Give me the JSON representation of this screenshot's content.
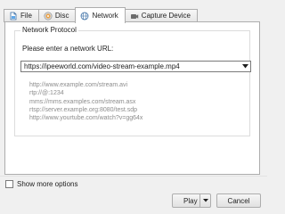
{
  "tabs": [
    {
      "label": "File",
      "icon": "file-icon",
      "active": false
    },
    {
      "label": "Disc",
      "icon": "disc-icon",
      "active": false
    },
    {
      "label": "Network",
      "icon": "network-icon",
      "active": true
    },
    {
      "label": "Capture Device",
      "icon": "capture-device-icon",
      "active": false
    }
  ],
  "network": {
    "group_title": "Network Protocol",
    "prompt": "Please enter a network URL:",
    "url_value": "https://ipeeworld.com/video-stream-example.mp4",
    "examples": [
      "http://www.example.com/stream.avi",
      "rtp://@:1234",
      "mms://mms.examples.com/stream.asx",
      "rtsp://server.example.org:8080/test.sdp",
      "http://www.yourtube.com/watch?v=gg64x"
    ]
  },
  "footer": {
    "show_more_label": "Show more options",
    "show_more_checked": false,
    "play_label": "Play",
    "cancel_label": "Cancel"
  }
}
